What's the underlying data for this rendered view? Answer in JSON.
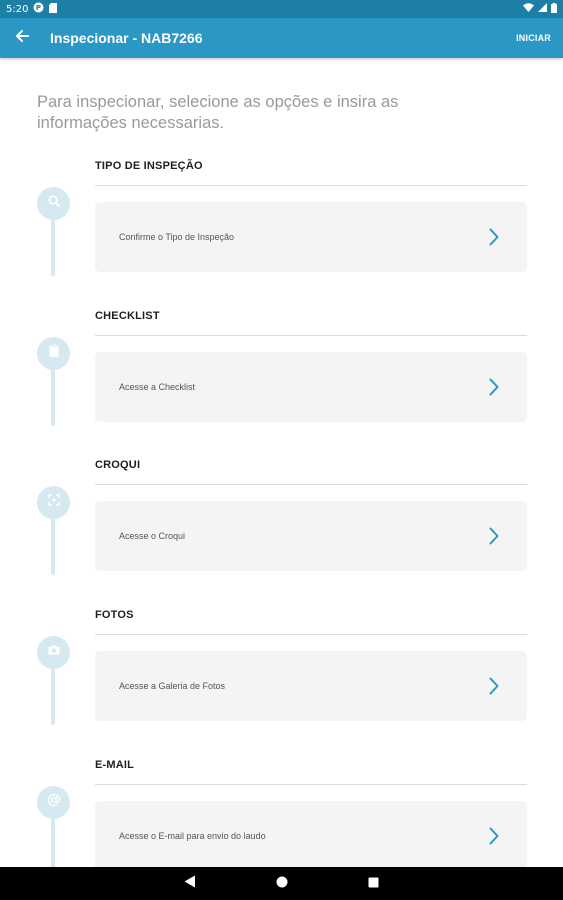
{
  "status_bar": {
    "time": "5:20",
    "icons": [
      "app-notification-icon",
      "sim-card-icon",
      "wifi-icon",
      "signal-icon",
      "battery-icon"
    ]
  },
  "app_bar": {
    "back_icon": "arrow-left-icon",
    "title": "Inspecionar - NAB7266",
    "action_label": "INICIAR"
  },
  "intro_text": "Para inspecionar, selecione as opções e insira as informações necessarias.",
  "steps": [
    {
      "title": "TIPO DE INSPEÇÃO",
      "card_label": "Confirme o Tipo de Inspeção",
      "icon": "search-icon"
    },
    {
      "title": "CHECKLIST",
      "card_label": "Acesse a Checklist",
      "icon": "clipboard-icon"
    },
    {
      "title": "CROQUI",
      "card_label": "Acesse o Croqui",
      "icon": "sketch-frame-icon"
    },
    {
      "title": "FOTOS",
      "card_label": "Acesse a Galeria de Fotos",
      "icon": "camera-icon"
    },
    {
      "title": "E-MAIL",
      "card_label": "Acesse o E-mail para envio do laudo",
      "icon": "at-sign-icon"
    }
  ],
  "nav_bar": {
    "icons": [
      "back-triangle-icon",
      "home-circle-icon",
      "recents-square-icon"
    ]
  },
  "colors": {
    "status_bar": "#1d7fa6",
    "app_bar": "#2a97c4",
    "accent": "#2a97c4",
    "timeline": "#d6e9f1",
    "card_bg": "#f4f4f4",
    "intro_text": "#9a9a9a"
  }
}
